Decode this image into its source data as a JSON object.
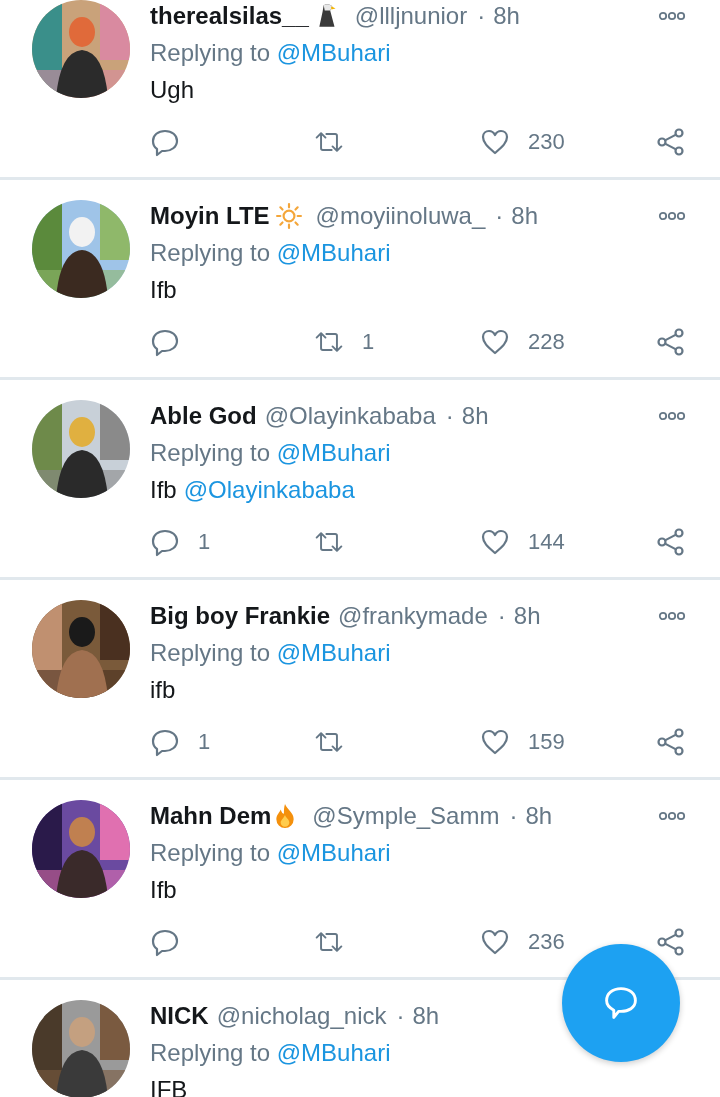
{
  "replies": [
    {
      "name": "therealsilas__",
      "badge": {
        "kind": "eagle"
      },
      "handle": "@llljnunior",
      "separator": "·",
      "time": "8h",
      "replying_label": "Replying to",
      "replying_to": "@MBuhari",
      "body": "Ugh",
      "actions": {
        "like_count": "230"
      }
    },
    {
      "name": "Moyin LTE",
      "badge": {
        "kind": "sun"
      },
      "handle": "@moyiinoluwa_",
      "separator": "·",
      "time": "8h",
      "replying_label": "Replying to",
      "replying_to": "@MBuhari",
      "body": "Ifb",
      "actions": {
        "retweet_count": "1",
        "like_count": "228"
      }
    },
    {
      "name": "Able God",
      "handle": "@Olayinkababa",
      "separator": "·",
      "time": "8h",
      "replying_label": "Replying to",
      "replying_to": "@MBuhari",
      "body": "Ifb",
      "body_mention": "@Olayinkababa",
      "actions": {
        "reply_count": "1",
        "like_count": "144"
      }
    },
    {
      "name": "Big boy Frankie",
      "handle": "@frankymade",
      "separator": "·",
      "time": "8h",
      "replying_label": "Replying to",
      "replying_to": "@MBuhari",
      "body": "ifb",
      "actions": {
        "reply_count": "1",
        "like_count": "159"
      }
    },
    {
      "name": "Mahn Dem",
      "badge": {
        "kind": "fire"
      },
      "handle": "@Symple_Samm",
      "separator": "·",
      "time": "8h",
      "replying_label": "Replying to",
      "replying_to": "@MBuhari",
      "body": "Ifb",
      "actions": {
        "like_count": "236"
      }
    },
    {
      "name": "NICK",
      "handle": "@nicholag_nick",
      "separator": "·",
      "time": "8h",
      "replying_label": "Replying to",
      "replying_to": "@MBuhari",
      "body": "IFB"
    }
  ]
}
